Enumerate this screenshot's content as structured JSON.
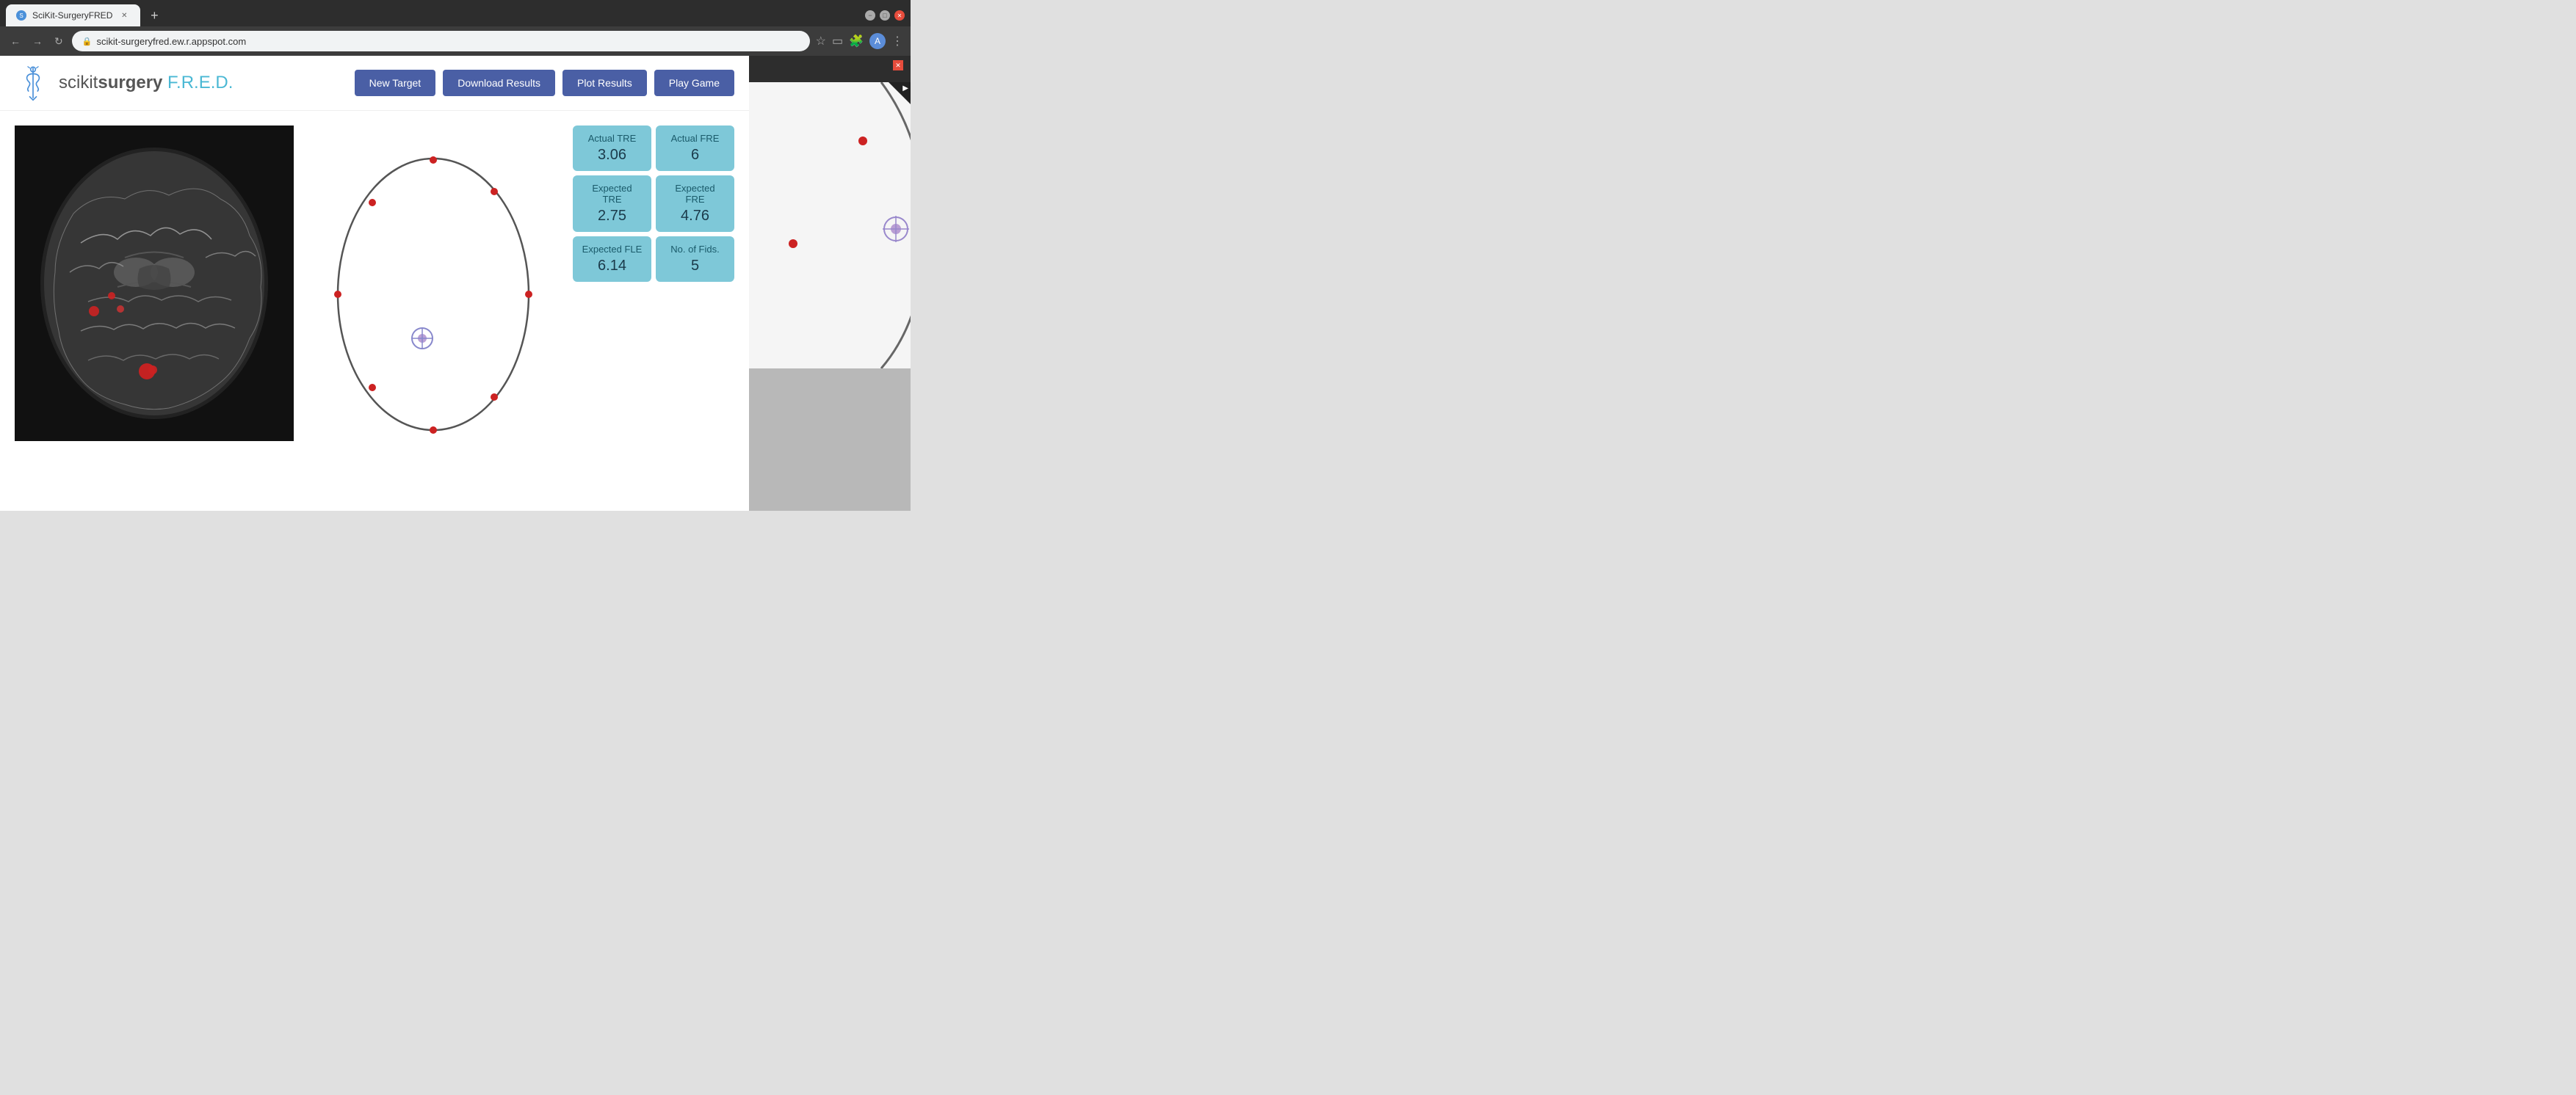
{
  "browser": {
    "tab_title": "SciKit-SurgeryFRED",
    "url": "scikit-surgeryfred.ew.r.appspot.com",
    "new_tab_label": "+",
    "nav": {
      "back": "←",
      "forward": "→",
      "refresh": "↻"
    },
    "window_controls": {
      "minimize": "−",
      "maximize": "□",
      "close": "✕"
    }
  },
  "app": {
    "logo_text_scikit": "scikit",
    "logo_text_surgery": "surgery",
    "logo_text_fred": " F.R.E.D.",
    "buttons": {
      "new_target": "New Target",
      "download_results": "Download Results",
      "plot_results": "Plot Results",
      "play_game": "Play Game"
    }
  },
  "stats": [
    {
      "label": "Actual TRE",
      "value": "3.06"
    },
    {
      "label": "Actual FRE",
      "value": "6"
    },
    {
      "label": "Expected TRE",
      "value": "2.75"
    },
    {
      "label": "Expected FRE",
      "value": "4.76"
    },
    {
      "label": "Expected FLE",
      "value": "6.14"
    },
    {
      "label": "No. of Fids.",
      "value": "5"
    }
  ],
  "colors": {
    "button_bg": "#4a5fa5",
    "stat_bg": "#7ec8d8",
    "stat_label": "#1a5a6a",
    "stat_value": "#1a3a4a",
    "fiducial_red": "#cc2222",
    "target_blue": "#6666cc",
    "brain_outline": "#555555"
  }
}
